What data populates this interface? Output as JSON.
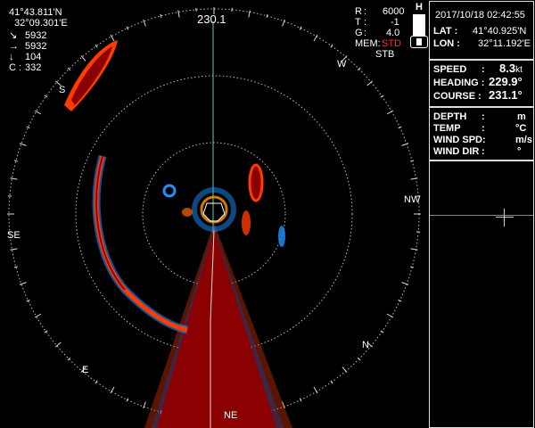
{
  "top_left": {
    "lat": "41°43.811'N",
    "lon": "32°09.301'E",
    "rows": [
      {
        "icon": "arrow-down-right-icon",
        "glyph": "↘",
        "value": "5932"
      },
      {
        "icon": "arrow-right-icon",
        "glyph": "→",
        "value": "5932"
      },
      {
        "icon": "arrow-down-icon",
        "glyph": "↓",
        "value": "104"
      },
      {
        "label": "C",
        "value": "332"
      }
    ]
  },
  "heading_readout": "230.1",
  "top_right": {
    "r_label": "R",
    "r_value": "6000",
    "t_label": "T",
    "t_value": "-1",
    "g_label": "G",
    "g_value": "4.0",
    "mem_label": "MEM:",
    "mem_value": "STD",
    "stb": "STB",
    "h_label": "H"
  },
  "compass": {
    "w": "W",
    "s": "S",
    "nw": "NW",
    "se": "SE",
    "n": "N",
    "e": "E",
    "ne": "NE"
  },
  "panel": {
    "datetime": "2017/10/18 02:42:55",
    "lat_label": "LAT :",
    "lat_value": "41°40.925'N",
    "lon_label": "LON :",
    "lon_value": "32°11.192'E",
    "speed_label": "SPEED",
    "speed_sep": ":",
    "speed_value": "8.3",
    "speed_unit": "kt",
    "heading_label": "HEADING :",
    "heading_value": "229.9°",
    "course_label": "COURSE :",
    "course_value": "231.1°",
    "depth_label": "DEPTH",
    "depth_sep": ":",
    "depth_unit": "m",
    "temp_label": "TEMP",
    "temp_sep": ":",
    "temp_unit": "°C",
    "wind_spd_label": "WIND SPD:",
    "wind_spd_unit": "m/s",
    "wind_dir_label": "WIND DIR",
    "wind_dir_sep": ":",
    "wind_dir_unit": "°"
  },
  "colors": {
    "accent_line": "#66ccaa",
    "echo_main": "#8b0000",
    "echo_edge": "#ff3b00",
    "crosshair": "#d6d66a",
    "mem_value": "#ff2a2a"
  }
}
